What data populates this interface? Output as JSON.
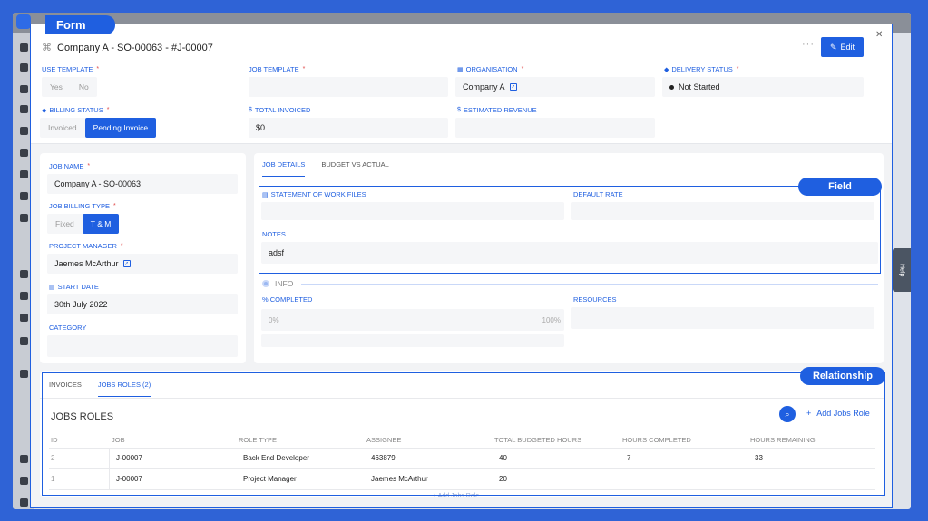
{
  "form_tag": "Form",
  "title": "Company A - SO-00063 - #J-00007",
  "edit_label": "Edit",
  "top_fields": {
    "use_template": {
      "label": "USE TEMPLATE",
      "options": [
        "Yes",
        "No"
      ]
    },
    "job_template": {
      "label": "JOB TEMPLATE"
    },
    "organisation": {
      "label": "ORGANISATION",
      "value": "Company A"
    },
    "delivery_status": {
      "label": "DELIVERY STATUS",
      "value": "Not Started"
    },
    "billing_status": {
      "label": "BILLING STATUS",
      "options": [
        "Invoiced",
        "Pending Invoice"
      ],
      "selected": "Pending Invoice"
    },
    "total_invoiced": {
      "label": "TOTAL INVOICED",
      "value": "$0"
    },
    "estimated_revenue": {
      "label": "ESTIMATED REVENUE"
    }
  },
  "left_card": {
    "job_name": {
      "label": "JOB NAME",
      "value": "Company A - SO-00063"
    },
    "job_billing_type": {
      "label": "JOB BILLING TYPE",
      "options": [
        "Fixed",
        "T & M"
      ],
      "selected": "T & M"
    },
    "project_manager": {
      "label": "PROJECT MANAGER",
      "value": "Jaemes McArthur"
    },
    "start_date": {
      "label": "START DATE",
      "value": "30th July 2022"
    },
    "category": {
      "label": "CATEGORY"
    }
  },
  "detail_tabs": [
    "JOB DETAILS",
    "BUDGET VS ACTUAL"
  ],
  "field_tag": "Field",
  "details": {
    "sow_label": "STATEMENT OF WORK FILES",
    "default_rate_label": "DEFAULT RATE",
    "notes_label": "NOTES",
    "notes_value": "adsf"
  },
  "info": {
    "label": "INFO",
    "completed_label": "% COMPLETED",
    "completed_min": "0%",
    "completed_max": "100%",
    "resources_label": "RESOURCES"
  },
  "relationship_tag": "Relationship",
  "relation_tabs": [
    "INVOICES",
    "JOBS ROLES (2)"
  ],
  "jobs_roles": {
    "title": "JOBS ROLES",
    "add_label": "Add Jobs Role",
    "footer_add": "+ Add Jobs Role",
    "columns": [
      "ID",
      "JOB",
      "ROLE TYPE",
      "ASSIGNEE",
      "TOTAL BUDGETED HOURS",
      "HOURS COMPLETED",
      "HOURS REMAINING"
    ],
    "rows": [
      [
        "2",
        "J-00007",
        "Back End Developer",
        "463879",
        "40",
        "7",
        "33"
      ],
      [
        "1",
        "J-00007",
        "Project Manager",
        "Jaemes McArthur",
        "20",
        "",
        ""
      ]
    ]
  },
  "help_label": "Help"
}
